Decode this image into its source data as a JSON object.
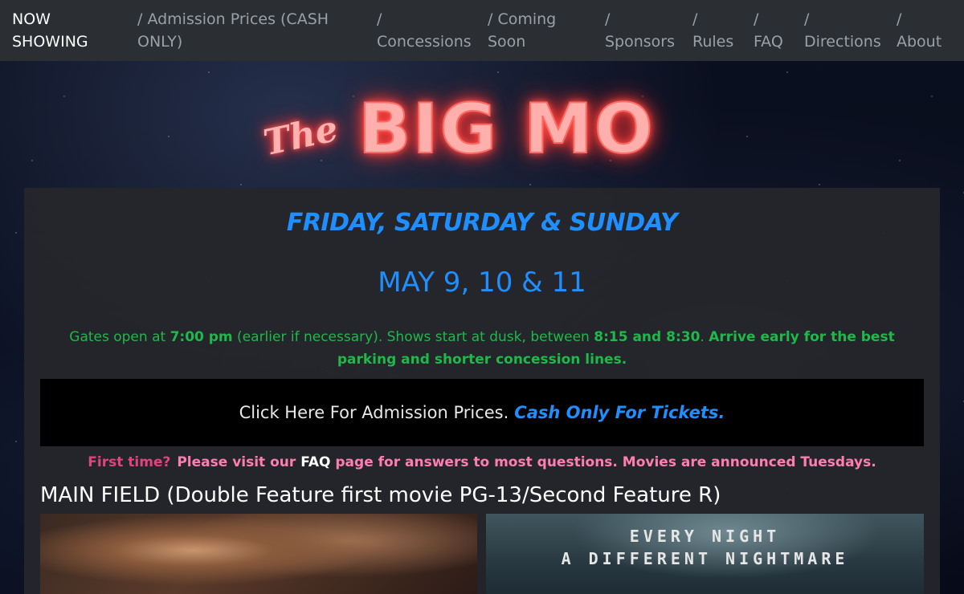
{
  "nav": {
    "items": [
      {
        "label": "NOW\nSHOWING",
        "active": true
      },
      {
        "label": "/ Admission Prices (CASH\nONLY)"
      },
      {
        "label": "/\nConcessions"
      },
      {
        "label": "/ Coming\nSoon"
      },
      {
        "label": "/\nSponsors"
      },
      {
        "label": "/\nRules"
      },
      {
        "label": "/\nFAQ"
      },
      {
        "label": "/\nDirections"
      },
      {
        "label": "/\nAbout"
      }
    ]
  },
  "logo": {
    "the": "The",
    "main": "BIG MO"
  },
  "schedule": {
    "days": "FRIDAY, SATURDAY & SUNDAY",
    "dates": "MAY 9, 10 & 11",
    "gates_prefix": "Gates open at ",
    "gates_time": "7:00 pm",
    "gates_middle": " (earlier if necessary). Shows start at dusk, between ",
    "show_window": "8:15 and 8:30",
    "gates_period": ". ",
    "arrive_note": "Arrive early for the best parking and shorter concession lines."
  },
  "admission": {
    "link_text": "Click Here For Admission Prices.",
    "cash_note": "Cash Only For Tickets."
  },
  "notice": {
    "question": "First time?",
    "pre": "Please visit our ",
    "faq": "FAQ",
    "post": " page for answers to most questions. Movies are announced Tuesdays."
  },
  "main_field": {
    "title": "MAIN FIELD (Double Feature first movie PG-13/Second Feature R)"
  },
  "posters": {
    "right_tagline": "EVERY NIGHT\nA DIFFERENT NIGHTMARE"
  },
  "colors": {
    "accent_blue": "#1f8fff",
    "green": "#1fb84a",
    "pink": "#ff7eb1",
    "neon": "#ff5a55"
  }
}
